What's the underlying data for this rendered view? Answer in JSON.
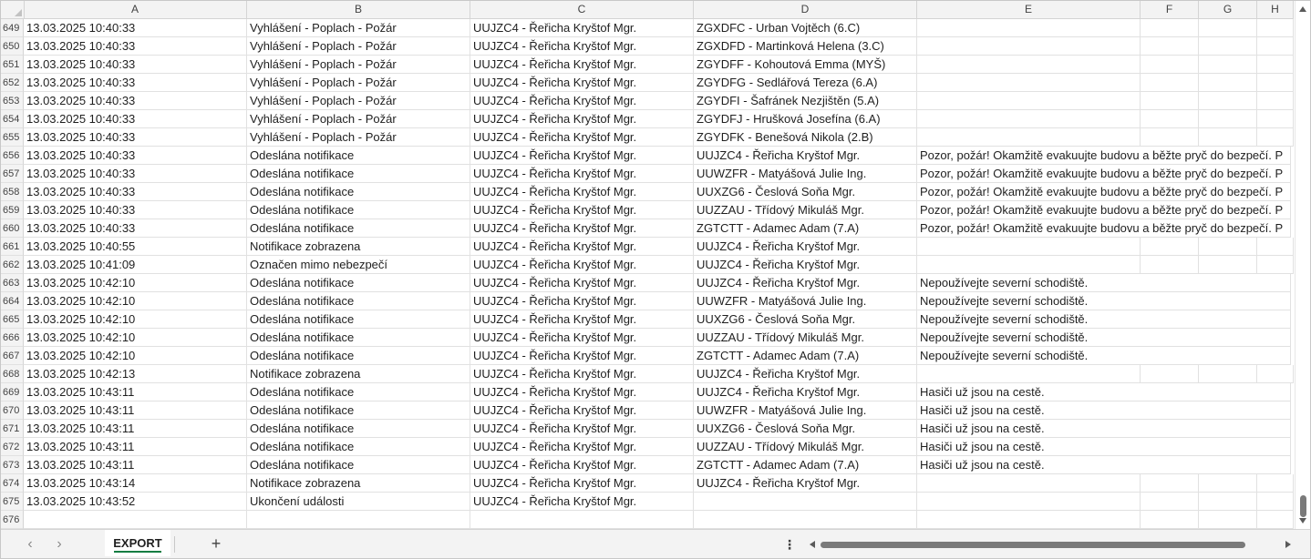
{
  "columns": [
    "A",
    "B",
    "C",
    "D",
    "E",
    "F",
    "G",
    "H"
  ],
  "rows": [
    {
      "n": "649",
      "a": "13.03.2025 10:40:33",
      "b": "Vyhlášení - Poplach - Požár",
      "c": "UUJZC4 - Řeřicha Kryštof Mgr.",
      "d": "ZGXDFC - Urban Vojtěch (6.C)",
      "e": ""
    },
    {
      "n": "650",
      "a": "13.03.2025 10:40:33",
      "b": "Vyhlášení - Poplach - Požár",
      "c": "UUJZC4 - Řeřicha Kryštof Mgr.",
      "d": "ZGXDFD - Martinková Helena (3.C)",
      "e": ""
    },
    {
      "n": "651",
      "a": "13.03.2025 10:40:33",
      "b": "Vyhlášení - Poplach - Požár",
      "c": "UUJZC4 - Řeřicha Kryštof Mgr.",
      "d": "ZGYDFF - Kohoutová Emma (MYŠ)",
      "e": ""
    },
    {
      "n": "652",
      "a": "13.03.2025 10:40:33",
      "b": "Vyhlášení - Poplach - Požár",
      "c": "UUJZC4 - Řeřicha Kryštof Mgr.",
      "d": "ZGYDFG - Sedlářová Tereza (6.A)",
      "e": ""
    },
    {
      "n": "653",
      "a": "13.03.2025 10:40:33",
      "b": "Vyhlášení - Poplach - Požár",
      "c": "UUJZC4 - Řeřicha Kryštof Mgr.",
      "d": "ZGYDFI - Šafránek Nezjištěn (5.A)",
      "e": ""
    },
    {
      "n": "654",
      "a": "13.03.2025 10:40:33",
      "b": "Vyhlášení - Poplach - Požár",
      "c": "UUJZC4 - Řeřicha Kryštof Mgr.",
      "d": "ZGYDFJ - Hrušková Josefína (6.A)",
      "e": ""
    },
    {
      "n": "655",
      "a": "13.03.2025 10:40:33",
      "b": "Vyhlášení - Poplach - Požár",
      "c": "UUJZC4 - Řeřicha Kryštof Mgr.",
      "d": "ZGYDFK - Benešová Nikola (2.B)",
      "e": ""
    },
    {
      "n": "656",
      "a": "13.03.2025 10:40:33",
      "b": "Odeslána notifikace",
      "c": "UUJZC4 - Řeřicha Kryštof Mgr.",
      "d": "UUJZC4 - Řeřicha Kryštof Mgr.",
      "e": "Pozor, požár! Okamžitě evakuujte budovu a běžte pryč do bezpečí. P"
    },
    {
      "n": "657",
      "a": "13.03.2025 10:40:33",
      "b": "Odeslána notifikace",
      "c": "UUJZC4 - Řeřicha Kryštof Mgr.",
      "d": "UUWZFR - Matyášová Julie Ing.",
      "e": "Pozor, požár! Okamžitě evakuujte budovu a běžte pryč do bezpečí. P"
    },
    {
      "n": "658",
      "a": "13.03.2025 10:40:33",
      "b": "Odeslána notifikace",
      "c": "UUJZC4 - Řeřicha Kryštof Mgr.",
      "d": "UUXZG6 - Česlová Soňa Mgr.",
      "e": "Pozor, požár! Okamžitě evakuujte budovu a běžte pryč do bezpečí. P"
    },
    {
      "n": "659",
      "a": "13.03.2025 10:40:33",
      "b": "Odeslána notifikace",
      "c": "UUJZC4 - Řeřicha Kryštof Mgr.",
      "d": "UUZZAU - Třídový Mikuláš Mgr.",
      "e": "Pozor, požár! Okamžitě evakuujte budovu a běžte pryč do bezpečí. P"
    },
    {
      "n": "660",
      "a": "13.03.2025 10:40:33",
      "b": "Odeslána notifikace",
      "c": "UUJZC4 - Řeřicha Kryštof Mgr.",
      "d": "ZGTCTT - Adamec Adam (7.A)",
      "e": "Pozor, požár! Okamžitě evakuujte budovu a běžte pryč do bezpečí. P"
    },
    {
      "n": "661",
      "a": "13.03.2025 10:40:55",
      "b": "Notifikace zobrazena",
      "c": "UUJZC4 - Řeřicha Kryštof Mgr.",
      "d": "UUJZC4 - Řeřicha Kryštof Mgr.",
      "e": ""
    },
    {
      "n": "662",
      "a": "13.03.2025 10:41:09",
      "b": "Označen mimo nebezpečí",
      "c": "UUJZC4 - Řeřicha Kryštof Mgr.",
      "d": "UUJZC4 - Řeřicha Kryštof Mgr.",
      "e": ""
    },
    {
      "n": "663",
      "a": "13.03.2025 10:42:10",
      "b": "Odeslána notifikace",
      "c": "UUJZC4 - Řeřicha Kryštof Mgr.",
      "d": "UUJZC4 - Řeřicha Kryštof Mgr.",
      "e": "Nepoužívejte severní schodiště."
    },
    {
      "n": "664",
      "a": "13.03.2025 10:42:10",
      "b": "Odeslána notifikace",
      "c": "UUJZC4 - Řeřicha Kryštof Mgr.",
      "d": "UUWZFR - Matyášová Julie Ing.",
      "e": "Nepoužívejte severní schodiště."
    },
    {
      "n": "665",
      "a": "13.03.2025 10:42:10",
      "b": "Odeslána notifikace",
      "c": "UUJZC4 - Řeřicha Kryštof Mgr.",
      "d": "UUXZG6 - Česlová Soňa Mgr.",
      "e": "Nepoužívejte severní schodiště."
    },
    {
      "n": "666",
      "a": "13.03.2025 10:42:10",
      "b": "Odeslána notifikace",
      "c": "UUJZC4 - Řeřicha Kryštof Mgr.",
      "d": "UUZZAU - Třídový Mikuláš Mgr.",
      "e": "Nepoužívejte severní schodiště."
    },
    {
      "n": "667",
      "a": "13.03.2025 10:42:10",
      "b": "Odeslána notifikace",
      "c": "UUJZC4 - Řeřicha Kryštof Mgr.",
      "d": "ZGTCTT - Adamec Adam (7.A)",
      "e": "Nepoužívejte severní schodiště."
    },
    {
      "n": "668",
      "a": "13.03.2025 10:42:13",
      "b": "Notifikace zobrazena",
      "c": "UUJZC4 - Řeřicha Kryštof Mgr.",
      "d": "UUJZC4 - Řeřicha Kryštof Mgr.",
      "e": ""
    },
    {
      "n": "669",
      "a": "13.03.2025 10:43:11",
      "b": "Odeslána notifikace",
      "c": "UUJZC4 - Řeřicha Kryštof Mgr.",
      "d": "UUJZC4 - Řeřicha Kryštof Mgr.",
      "e": "Hasiči už jsou na cestě."
    },
    {
      "n": "670",
      "a": "13.03.2025 10:43:11",
      "b": "Odeslána notifikace",
      "c": "UUJZC4 - Řeřicha Kryštof Mgr.",
      "d": "UUWZFR - Matyášová Julie Ing.",
      "e": "Hasiči už jsou na cestě."
    },
    {
      "n": "671",
      "a": "13.03.2025 10:43:11",
      "b": "Odeslána notifikace",
      "c": "UUJZC4 - Řeřicha Kryštof Mgr.",
      "d": "UUXZG6 - Česlová Soňa Mgr.",
      "e": "Hasiči už jsou na cestě."
    },
    {
      "n": "672",
      "a": "13.03.2025 10:43:11",
      "b": "Odeslána notifikace",
      "c": "UUJZC4 - Řeřicha Kryštof Mgr.",
      "d": "UUZZAU - Třídový Mikuláš Mgr.",
      "e": "Hasiči už jsou na cestě."
    },
    {
      "n": "673",
      "a": "13.03.2025 10:43:11",
      "b": "Odeslána notifikace",
      "c": "UUJZC4 - Řeřicha Kryštof Mgr.",
      "d": "ZGTCTT - Adamec Adam (7.A)",
      "e": "Hasiči už jsou na cestě."
    },
    {
      "n": "674",
      "a": "13.03.2025 10:43:14",
      "b": "Notifikace zobrazena",
      "c": "UUJZC4 - Řeřicha Kryštof Mgr.",
      "d": "UUJZC4 - Řeřicha Kryštof Mgr.",
      "e": ""
    },
    {
      "n": "675",
      "a": "13.03.2025 10:43:52",
      "b": "Ukončení události",
      "c": "UUJZC4 - Řeřicha Kryštof Mgr.",
      "d": "",
      "e": ""
    },
    {
      "n": "676",
      "a": "",
      "b": "",
      "c": "",
      "d": "",
      "e": ""
    }
  ],
  "sheet_tabs": [
    {
      "label": "EXPORT",
      "active": true
    }
  ],
  "bottom": {
    "prev_glyph": "‹",
    "next_glyph": "›",
    "add_glyph": "+",
    "more_glyph": "⋮"
  },
  "icons": {
    "prev": "chevron-left-icon",
    "next": "chevron-right-icon",
    "add": "plus-icon",
    "more": "more-vertical-icon"
  },
  "colors": {
    "active_tab_underline": "#107c41",
    "header_bg": "#f3f3f3",
    "gridline": "#e1e1e1"
  }
}
